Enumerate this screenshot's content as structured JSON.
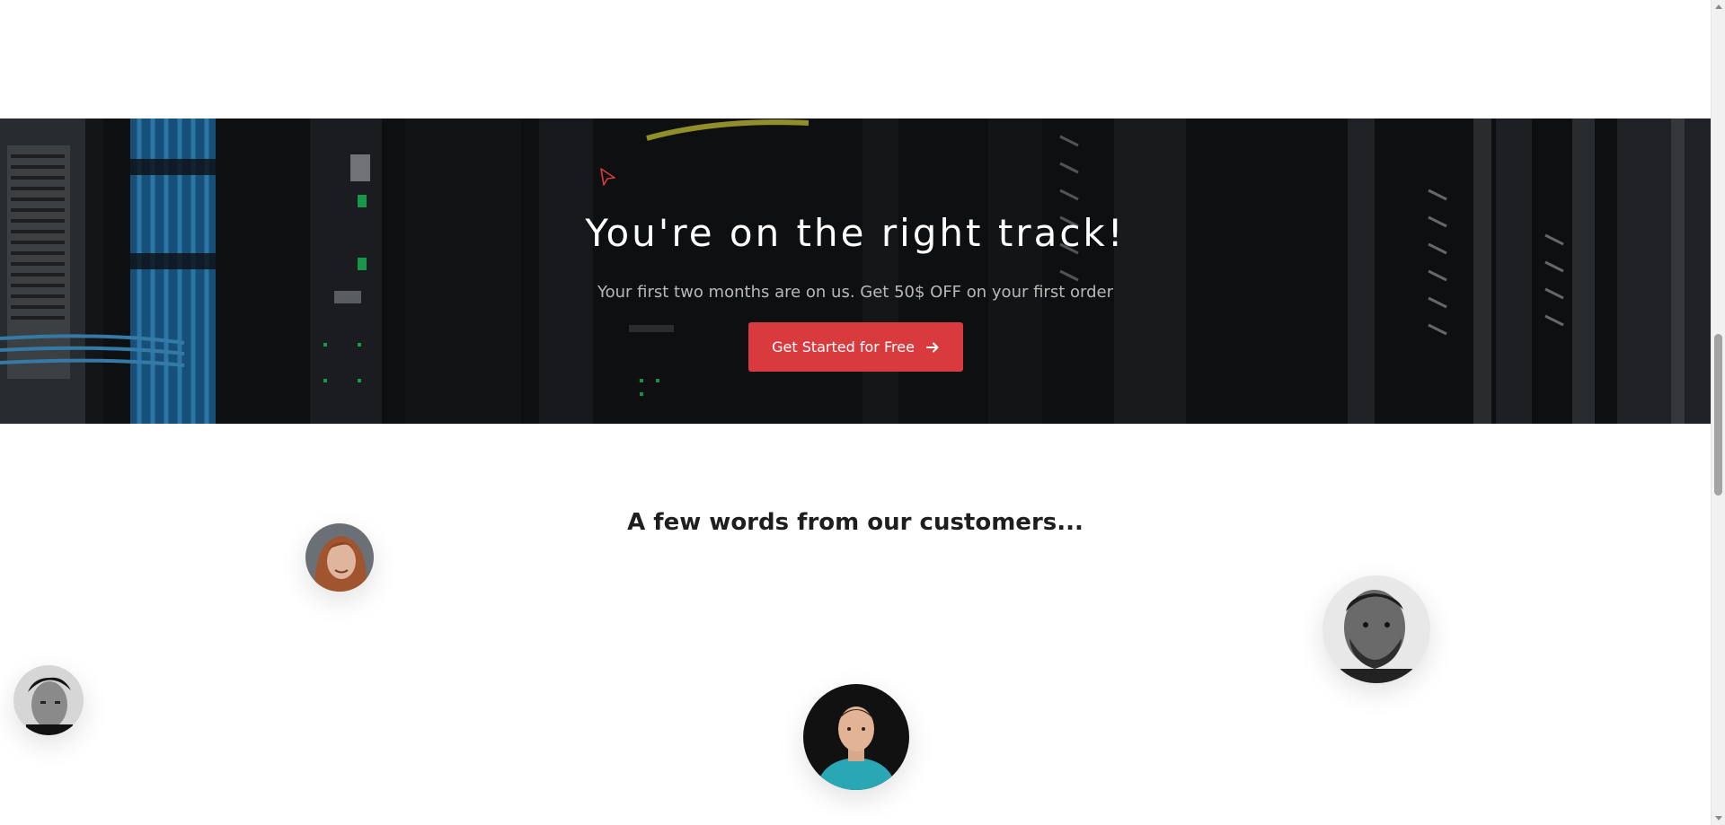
{
  "cta": {
    "title": "You're on the right track!",
    "subtitle": "Your first two months are on us. Get 50$ OFF on your first order",
    "button_label": "Get Started for Free",
    "button_icon": "arrow-right-icon",
    "button_color": "#d93a3d"
  },
  "testimonials": {
    "title": "A few words from our customers...",
    "avatars": [
      "woman-avatar",
      "bearded-man-avatar",
      "man-avatar-bw",
      "man-avatar-teal-shirt"
    ]
  }
}
